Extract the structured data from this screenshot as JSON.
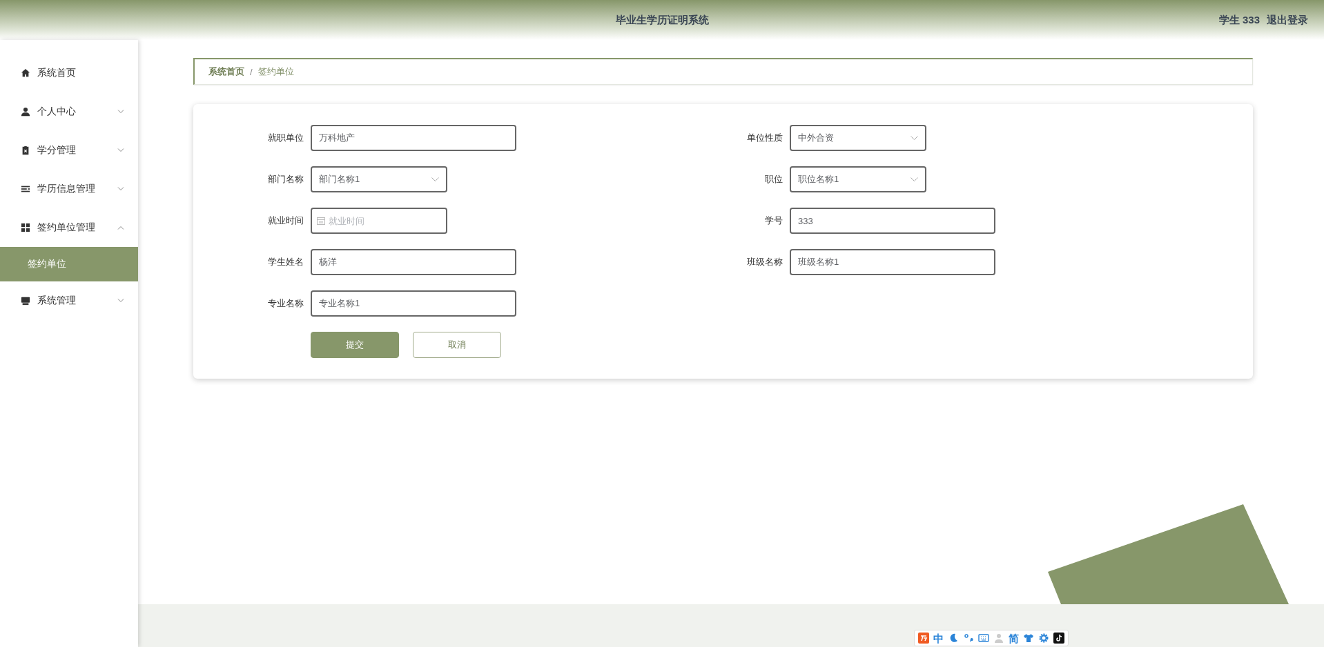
{
  "header": {
    "title": "毕业生学历证明系统",
    "user": "学生 333",
    "logout": "退出登录"
  },
  "sidebar": {
    "items": [
      {
        "label": "系统首页",
        "kind": "link"
      },
      {
        "label": "个人中心",
        "kind": "group",
        "expanded": false
      },
      {
        "label": "学分管理",
        "kind": "group",
        "expanded": false
      },
      {
        "label": "学历信息管理",
        "kind": "group",
        "expanded": false
      },
      {
        "label": "签约单位管理",
        "kind": "group",
        "expanded": true,
        "children": [
          {
            "label": "签约单位",
            "selected": true
          }
        ]
      },
      {
        "label": "系统管理",
        "kind": "group",
        "expanded": false
      }
    ]
  },
  "breadcrumb": {
    "items": [
      "系统首页",
      "签约单位"
    ],
    "separator": "/"
  },
  "form": {
    "left": [
      {
        "label": "就职单位",
        "kind": "input",
        "value": "万科地产"
      },
      {
        "label": "部门名称",
        "kind": "select",
        "value": "部门名称1"
      },
      {
        "label": "就业时间",
        "kind": "date",
        "placeholder": "就业时间"
      },
      {
        "label": "学生姓名",
        "kind": "input",
        "value": "杨洋"
      },
      {
        "label": "专业名称",
        "kind": "input",
        "value": "专业名称1"
      }
    ],
    "right": [
      {
        "label": "单位性质",
        "kind": "select",
        "value": "中外合资"
      },
      {
        "label": "职位",
        "kind": "select",
        "value": "职位名称1"
      },
      {
        "label": "学号",
        "kind": "input",
        "value": "333"
      },
      {
        "label": "班级名称",
        "kind": "input",
        "value": "班级名称1"
      }
    ],
    "buttons": [
      {
        "label": "提交",
        "kind": "primary"
      },
      {
        "label": "取消",
        "kind": "default"
      }
    ]
  },
  "ime_bar": {
    "items": [
      {
        "kind": "logo"
      },
      {
        "kind": "text",
        "label": "中"
      },
      {
        "kind": "moon"
      },
      {
        "kind": "punct"
      },
      {
        "kind": "keyboard"
      },
      {
        "kind": "person"
      },
      {
        "kind": "text",
        "label": "简"
      },
      {
        "kind": "shirt"
      },
      {
        "kind": "gear"
      },
      {
        "kind": "note"
      }
    ]
  }
}
